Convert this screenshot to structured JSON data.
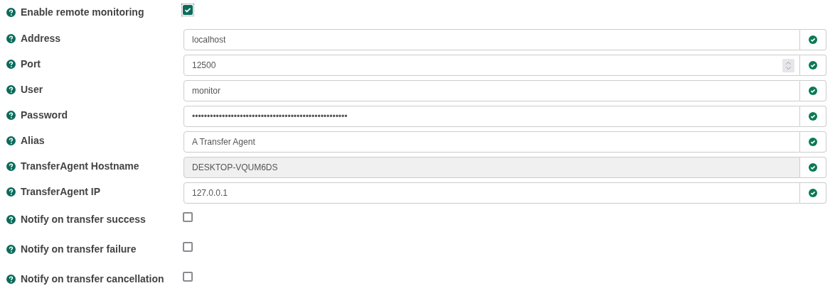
{
  "settings": [
    {
      "kind": "checkbox",
      "label": "Enable remote monitoring",
      "checked": true,
      "focused": true
    },
    {
      "kind": "text",
      "label": "Address",
      "value": "localhost",
      "disabled": false
    },
    {
      "kind": "number",
      "label": "Port",
      "value": "12500",
      "disabled": false
    },
    {
      "kind": "text",
      "label": "User",
      "value": "monitor",
      "disabled": false
    },
    {
      "kind": "text",
      "label": "Password",
      "value": "••••••••••••••••••••••••••••••••••••••••••••••••••••",
      "disabled": false
    },
    {
      "kind": "text",
      "label": "Alias",
      "value": "A Transfer Agent",
      "disabled": false
    },
    {
      "kind": "text",
      "label": "TransferAgent Hostname",
      "value": "DESKTOP-VQUM6DS",
      "disabled": true
    },
    {
      "kind": "text",
      "label": "TransferAgent IP",
      "value": "127.0.0.1",
      "disabled": false
    },
    {
      "kind": "checkbox",
      "label": "Notify on transfer success",
      "checked": false,
      "focused": false
    },
    {
      "kind": "checkbox",
      "label": "Notify on transfer failure",
      "checked": false,
      "focused": false
    },
    {
      "kind": "checkbox",
      "label": "Notify on transfer cancellation",
      "checked": false,
      "focused": false
    }
  ]
}
